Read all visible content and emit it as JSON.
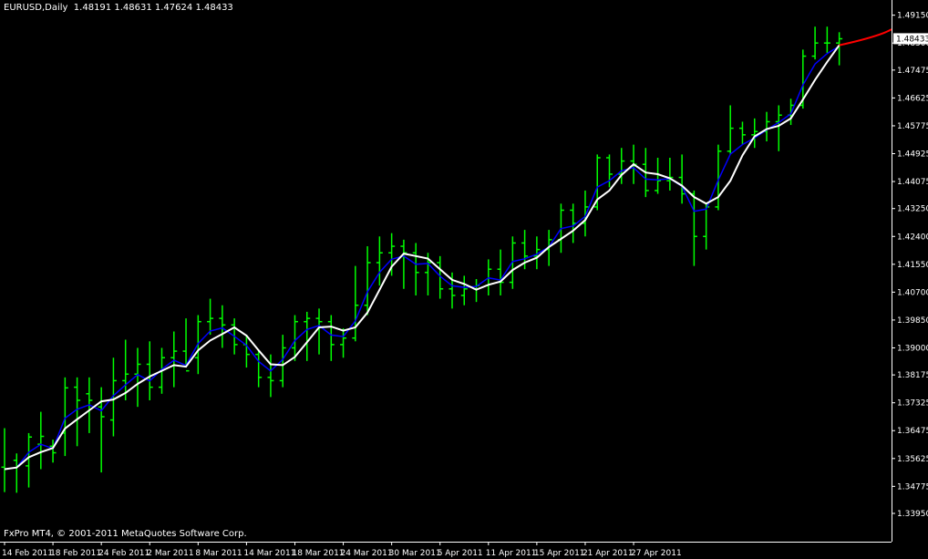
{
  "header": {
    "symbol": "EURUSD,Daily",
    "open": "1.48191",
    "high": "1.48631",
    "low": "1.47624",
    "close": "1.48433"
  },
  "footer": {
    "copyright": "FxPro MT4, © 2001-2011 MetaQuotes Software Corp."
  },
  "colors": {
    "background": "#000000",
    "bars": "#00ff00",
    "ma_white": "#ffffff",
    "ma_blue": "#0000ff",
    "forecast": "#ff0000",
    "axis": "#ffffff"
  },
  "chart_data": {
    "type": "ohlc",
    "price_scale": [
      "1.49150",
      "1.48300",
      "1.47475",
      "1.46625",
      "1.45775",
      "1.44925",
      "1.44075",
      "1.43250",
      "1.42400",
      "1.41550",
      "1.40700",
      "1.39850",
      "1.39000",
      "1.38175",
      "1.37325",
      "1.36475",
      "1.35625",
      "1.34775",
      "1.33950"
    ],
    "ylim": [
      1.3391,
      1.4935
    ],
    "current_price": "1.48433",
    "date_labels": [
      "14 Feb 2011",
      "18 Feb 2011",
      "24 Feb 2011",
      "2 Mar 2011",
      "8 Mar 2011",
      "14 Mar 2011",
      "18 Mar 2011",
      "24 Mar 2011",
      "30 Mar 2011",
      "5 Apr 2011",
      "11 Apr 2011",
      "15 Apr 2011",
      "21 Apr 2011",
      "27 Apr 2011"
    ],
    "date_label_bar_index": [
      0,
      4,
      8,
      12,
      16,
      20,
      24,
      28,
      32,
      36,
      40,
      44,
      48,
      52
    ],
    "bars": [
      [
        1.3536,
        1.3655,
        1.346,
        1.353
      ],
      [
        1.3557,
        1.3578,
        1.3458,
        1.354
      ],
      [
        1.354,
        1.364,
        1.3474,
        1.3628
      ],
      [
        1.3606,
        1.3705,
        1.353,
        1.363
      ],
      [
        1.36,
        1.362,
        1.355,
        1.358
      ],
      [
        1.364,
        1.381,
        1.357,
        1.3778
      ],
      [
        1.378,
        1.381,
        1.36,
        1.374
      ],
      [
        1.376,
        1.381,
        1.364,
        1.374
      ],
      [
        1.372,
        1.378,
        1.352,
        1.369
      ],
      [
        1.368,
        1.387,
        1.363,
        1.38
      ],
      [
        1.38,
        1.3925,
        1.374,
        1.382
      ],
      [
        1.382,
        1.39,
        1.372,
        1.385
      ],
      [
        1.385,
        1.392,
        1.374,
        1.378
      ],
      [
        1.378,
        1.39,
        1.376,
        1.387
      ],
      [
        1.387,
        1.395,
        1.378,
        1.389
      ],
      [
        1.389,
        1.399,
        1.384,
        1.383
      ],
      [
        1.387,
        1.4,
        1.382,
        1.398
      ],
      [
        1.398,
        1.405,
        1.394,
        1.399
      ],
      [
        1.399,
        1.403,
        1.39,
        1.397
      ],
      [
        1.397,
        1.399,
        1.388,
        1.391
      ],
      [
        1.391,
        1.394,
        1.384,
        1.388
      ],
      [
        1.388,
        1.389,
        1.378,
        1.381
      ],
      [
        1.381,
        1.388,
        1.375,
        1.38
      ],
      [
        1.38,
        1.394,
        1.378,
        1.39
      ],
      [
        1.39,
        1.4,
        1.386,
        1.398
      ],
      [
        1.398,
        1.401,
        1.386,
        1.399
      ],
      [
        1.399,
        1.402,
        1.388,
        1.398
      ],
      [
        1.398,
        1.4,
        1.386,
        1.391
      ],
      [
        1.391,
        1.396,
        1.387,
        1.393
      ],
      [
        1.393,
        1.415,
        1.392,
        1.403
      ],
      [
        1.403,
        1.421,
        1.4,
        1.416
      ],
      [
        1.416,
        1.424,
        1.409,
        1.419
      ],
      [
        1.419,
        1.425,
        1.412,
        1.421
      ],
      [
        1.421,
        1.423,
        1.408,
        1.419
      ],
      [
        1.419,
        1.422,
        1.406,
        1.413
      ],
      [
        1.413,
        1.419,
        1.406,
        1.416
      ],
      [
        1.416,
        1.418,
        1.405,
        1.408
      ],
      [
        1.408,
        1.413,
        1.402,
        1.406
      ],
      [
        1.406,
        1.412,
        1.403,
        1.408
      ],
      [
        1.408,
        1.411,
        1.404,
        1.409
      ],
      [
        1.409,
        1.417,
        1.406,
        1.414
      ],
      [
        1.414,
        1.42,
        1.406,
        1.41
      ],
      [
        1.41,
        1.424,
        1.408,
        1.422
      ],
      [
        1.422,
        1.426,
        1.414,
        1.418
      ],
      [
        1.418,
        1.424,
        1.414,
        1.42
      ],
      [
        1.42,
        1.426,
        1.415,
        1.423
      ],
      [
        1.423,
        1.434,
        1.419,
        1.432
      ],
      [
        1.432,
        1.434,
        1.422,
        1.428
      ],
      [
        1.428,
        1.438,
        1.424,
        1.433
      ],
      [
        1.433,
        1.449,
        1.432,
        1.448
      ],
      [
        1.448,
        1.449,
        1.439,
        1.443
      ],
      [
        1.443,
        1.451,
        1.44,
        1.447
      ],
      [
        1.447,
        1.452,
        1.44,
        1.446
      ],
      [
        1.446,
        1.451,
        1.436,
        1.438
      ],
      [
        1.438,
        1.448,
        1.437,
        1.441
      ],
      [
        1.441,
        1.448,
        1.438,
        1.442
      ],
      [
        1.442,
        1.449,
        1.434,
        1.437
      ],
      [
        1.437,
        1.438,
        1.415,
        1.424
      ],
      [
        1.424,
        1.434,
        1.42,
        1.433
      ],
      [
        1.433,
        1.452,
        1.432,
        1.45
      ],
      [
        1.45,
        1.464,
        1.449,
        1.457
      ],
      [
        1.457,
        1.459,
        1.452,
        1.455
      ],
      [
        1.455,
        1.46,
        1.451,
        1.456
      ],
      [
        1.456,
        1.462,
        1.453,
        1.459
      ],
      [
        1.459,
        1.464,
        1.45,
        1.461
      ],
      [
        1.461,
        1.466,
        1.458,
        1.464
      ],
      [
        1.464,
        1.481,
        1.463,
        1.479
      ],
      [
        1.479,
        1.488,
        1.478,
        1.483
      ],
      [
        1.483,
        1.488,
        1.48,
        1.483
      ],
      [
        1.483,
        1.4863,
        1.4762,
        1.4843
      ]
    ]
  }
}
